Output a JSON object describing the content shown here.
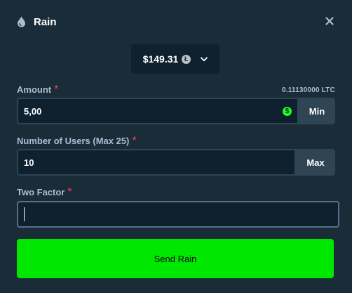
{
  "modal": {
    "title": "Rain",
    "icons": {
      "title": "droplet-icon",
      "close": "close-icon"
    }
  },
  "balance": {
    "amount": "$149.31",
    "currency_icon": "litecoin-icon",
    "dropdown_icon": "chevron-down-icon"
  },
  "amount_field": {
    "label": "Amount",
    "required_mark": "*",
    "crypto_equivalent": "0.11130000 LTC",
    "value": "5,00",
    "currency_icon": "dollar-coin-icon",
    "min_label": "Min"
  },
  "users_field": {
    "label": "Number of Users (Max 25)",
    "required_mark": "*",
    "value": "10",
    "max_label": "Max"
  },
  "two_factor_field": {
    "label": "Two Factor",
    "required_mark": "*",
    "value": ""
  },
  "submit": {
    "label": "Send Rain"
  },
  "colors": {
    "background": "#1a2c38",
    "input_bg": "#0f212e",
    "border": "#2f4553",
    "label": "#b1bad3",
    "required": "#ed4163",
    "accent_green": "#00e701"
  }
}
